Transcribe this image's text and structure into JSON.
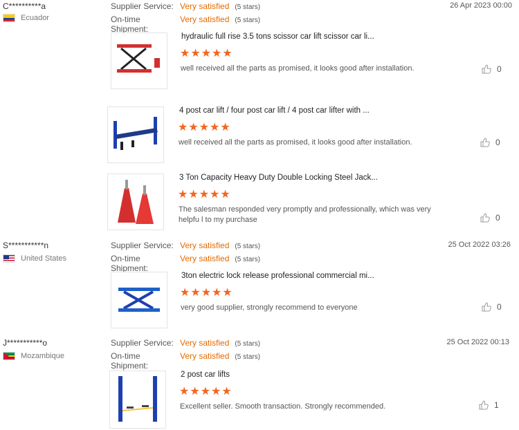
{
  "rating_labels": {
    "supplier_service": "Supplier Service:",
    "ontime_shipment": "On-time Shipment:"
  },
  "reviews": [
    {
      "buyer": "C**********a",
      "country": "Ecuador",
      "date": "26 Apr 2023 00:00",
      "supplier_service": {
        "value": "Very satisfied",
        "stars": "(5 stars)"
      },
      "ontime_shipment": {
        "value": "Very satisfied",
        "stars": "(5 stars)"
      },
      "items": [
        {
          "title": "hydraulic full rise 3.5 tons scissor car lift scissor car li...",
          "stars": "★★★★★",
          "rating": 5,
          "comment": "well received all the parts as promised, it looks good after installation.",
          "likes": "0",
          "image_icon": "red-scissor-lift-image"
        },
        {
          "title": "4 post car lift / four post car lift / 4 post car lifter with ...",
          "stars": "★★★★★",
          "rating": 5,
          "comment": "well received all the parts as promised, it looks good after installation.",
          "likes": "0",
          "image_icon": "blue-four-post-lift-image"
        },
        {
          "title": "3 Ton Capacity Heavy Duty Double Locking Steel Jack...",
          "stars": "★★★★★",
          "rating": 5,
          "comment": "The salesman responded very promptly and professionally, which was very helpfu l to my purchase",
          "likes": "0",
          "image_icon": "red-jack-stands-image"
        }
      ]
    },
    {
      "buyer": "S***********n",
      "country": "United States",
      "date": "25 Oct 2022 03:26",
      "supplier_service": {
        "value": "Very satisfied",
        "stars": "(5 stars)"
      },
      "ontime_shipment": {
        "value": "Very satisfied",
        "stars": "(5 stars)"
      },
      "items": [
        {
          "title": "3ton electric lock release professional commercial mi...",
          "stars": "★★★★★",
          "rating": 5,
          "comment": "very good supplier, strongly recommend to everyone",
          "likes": "0",
          "image_icon": "blue-scissor-lift-image"
        }
      ]
    },
    {
      "buyer": "J***********o",
      "country": "Mozambique",
      "date": "25 Oct 2022 00:13",
      "supplier_service": {
        "value": "Very satisfied",
        "stars": "(5 stars)"
      },
      "ontime_shipment": {
        "value": "Very satisfied",
        "stars": "(5 stars)"
      },
      "items": [
        {
          "title": "2 post car lifts",
          "stars": "★★★★★",
          "rating": 5,
          "comment": "Excellent seller. Smooth transaction. Strongly recommended.",
          "likes": "1",
          "image_icon": "blue-two-post-lift-image"
        }
      ]
    }
  ],
  "colors": {
    "accent": "#e46a00",
    "star": "#f2661f"
  }
}
